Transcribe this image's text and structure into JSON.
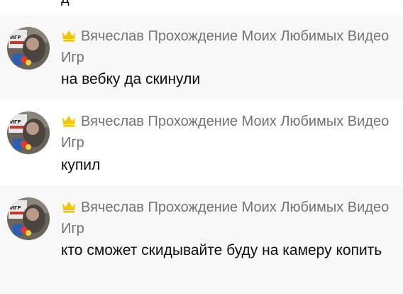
{
  "previous_message_tail": "д",
  "messages": [
    {
      "author": "Вячеслав Прохождение Моих Любимых Видео Игр",
      "badge": "crown-icon",
      "text": "на вебку да скинули"
    },
    {
      "author": "Вячеслав Прохождение Моих Любимых Видео Игр",
      "badge": "crown-icon",
      "text": "купил"
    },
    {
      "author": "Вячеслав Прохождение Моих Любимых Видео Игр",
      "badge": "crown-icon",
      "text": "кто сможет скидывайте буду на камеру копить"
    }
  ],
  "colors": {
    "author": "#737373",
    "text": "#0f0f0f",
    "alt_row_bg": "#f8f8f8",
    "crown": "#f5c400"
  }
}
